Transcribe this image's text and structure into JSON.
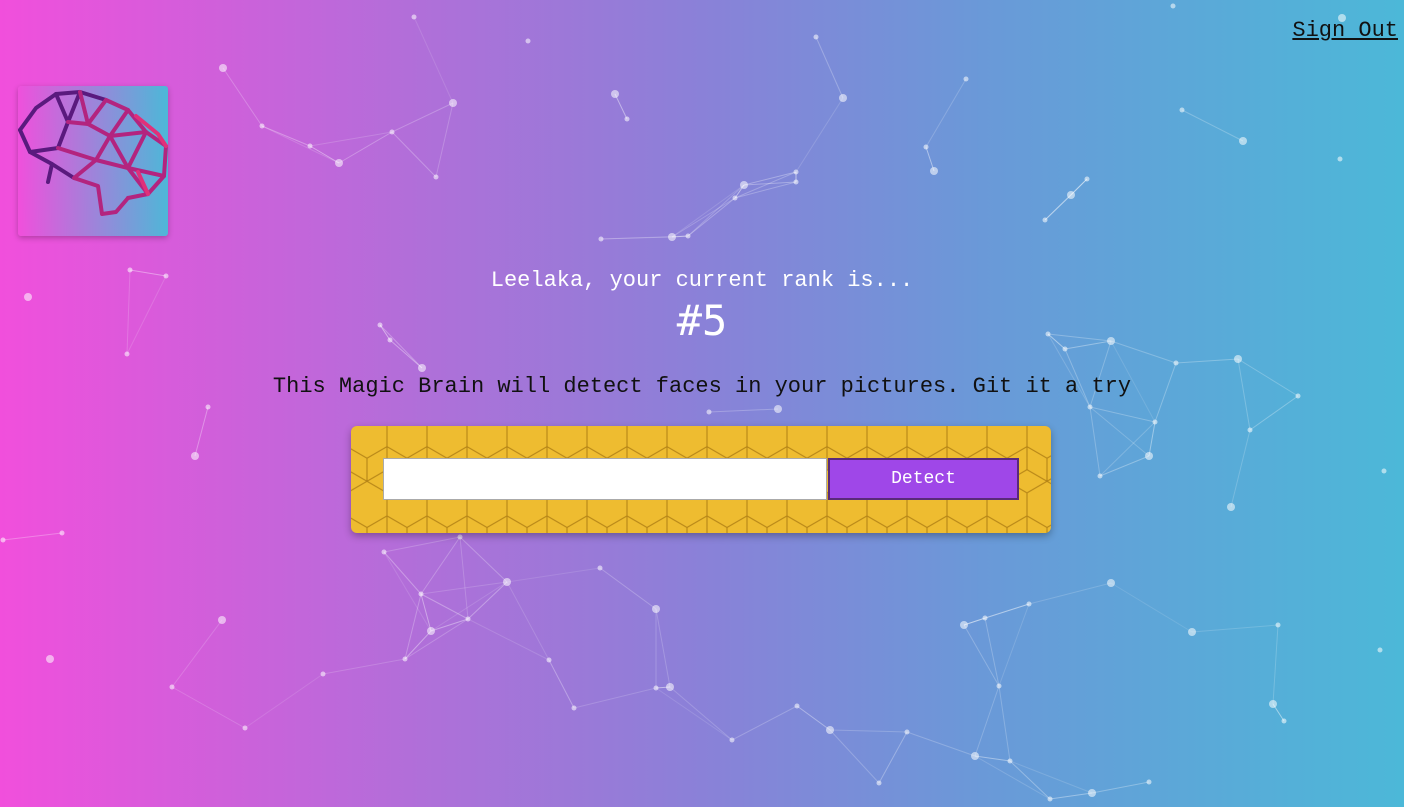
{
  "nav": {
    "sign_out_label": "Sign Out"
  },
  "logo": {
    "icon": "brain-icon"
  },
  "rank": {
    "message": "Leelaka, your current rank is...",
    "value": "#5"
  },
  "tagline": "This Magic Brain will detect faces in your pictures. Git it a try",
  "form": {
    "url_value": "",
    "url_placeholder": "",
    "detect_label": "Detect"
  },
  "colors": {
    "gradient_left": "#f14fdc",
    "gradient_right": "#4cb8d8",
    "form_background": "#eebc30",
    "button": "#9f47e8"
  }
}
